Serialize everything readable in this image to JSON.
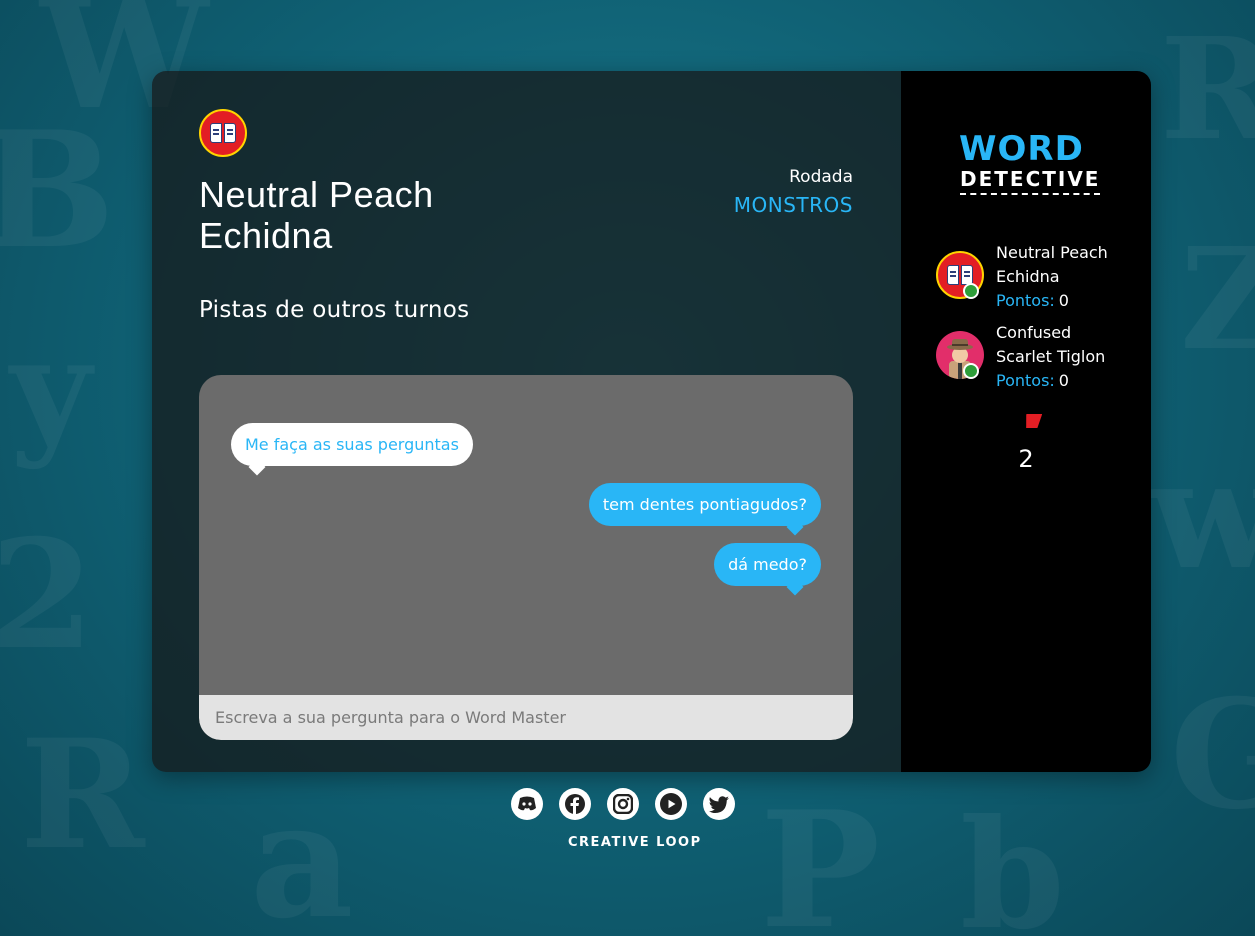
{
  "player": {
    "name": "Neutral Peach Echidna",
    "avatar_icon": "open-book-icon"
  },
  "round": {
    "label": "Rodada",
    "value": "MONSTROS"
  },
  "clues": {
    "heading": "Pistas de outros turnos"
  },
  "chat": {
    "messages": [
      {
        "side": "left",
        "text": "Me faça as suas perguntas"
      },
      {
        "side": "right",
        "text": "tem dentes pontiagudos?"
      },
      {
        "side": "right",
        "text": "dá medo?"
      }
    ],
    "input_placeholder": "Escreva a sua pergunta para o Word Master"
  },
  "logo": {
    "word": "WORD",
    "detective": "DETECTIVE"
  },
  "players": [
    {
      "name": "Neutral Peach Echidna",
      "points_label": "Pontos:",
      "points": "0",
      "status": "online",
      "avatar_icon": "open-book-icon"
    },
    {
      "name": "Confused Scarlet Tiglon",
      "points_label": "Pontos:",
      "points": "0",
      "status": "online",
      "avatar_icon": "detective-icon"
    }
  ],
  "timer": {
    "icon": "red-flag-icon",
    "value": "2"
  },
  "footer": {
    "socials": [
      "discord-icon",
      "facebook-icon",
      "instagram-icon",
      "youtube-icon",
      "twitter-icon"
    ],
    "brand": "CREATIVE LOOP"
  },
  "colors": {
    "accent": "#29b6f6",
    "online": "#2e9e3a",
    "avatar_red": "#e31e24",
    "background": "#1a7b8f"
  }
}
